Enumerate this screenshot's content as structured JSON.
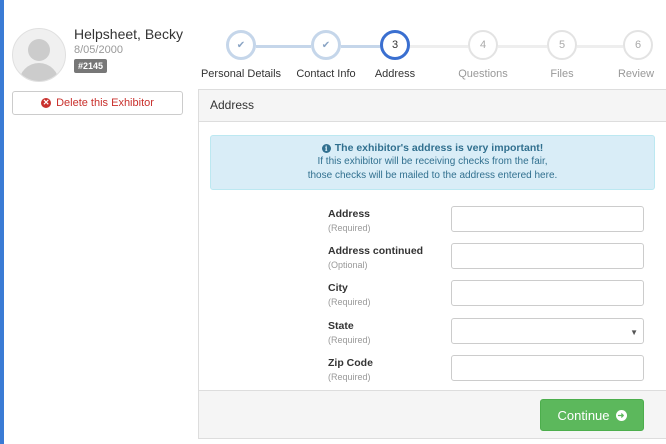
{
  "profile": {
    "name": "Helpsheet, Becky",
    "dob": "8/05/2000",
    "badge": "#2145",
    "delete_label": "Delete this Exhibitor"
  },
  "stepper": {
    "steps": [
      {
        "number": "",
        "label": "Personal Details",
        "state": "done",
        "icon": "check-icon"
      },
      {
        "number": "",
        "label": "Contact Info",
        "state": "done",
        "icon": "check-icon"
      },
      {
        "number": "3",
        "label": "Address",
        "state": "active"
      },
      {
        "number": "4",
        "label": "Questions",
        "state": "todo"
      },
      {
        "number": "5",
        "label": "Files",
        "state": "todo"
      },
      {
        "number": "6",
        "label": "Review",
        "state": "todo"
      }
    ]
  },
  "panel": {
    "heading": "Address",
    "alert": {
      "title": "The exhibitor's address is very important!",
      "line1": "If this exhibitor will be receiving checks from the fair,",
      "line2": "those checks will be mailed to the address entered here."
    },
    "fields": [
      {
        "label": "Address",
        "note": "(Required)",
        "value": "",
        "type": "text"
      },
      {
        "label": "Address continued",
        "note": "(Optional)",
        "value": "",
        "type": "text"
      },
      {
        "label": "City",
        "note": "(Required)",
        "value": "",
        "type": "text"
      },
      {
        "label": "State",
        "note": "(Required)",
        "value": "",
        "type": "select"
      },
      {
        "label": "Zip Code",
        "note": "(Required)",
        "value": "",
        "type": "text"
      }
    ],
    "continue_label": "Continue"
  },
  "colors": {
    "accent": "#3a6fd0",
    "step_done": "#c5d6ea",
    "success": "#5cb85c",
    "danger": "#c9302c",
    "info_bg": "#d9edf7"
  }
}
